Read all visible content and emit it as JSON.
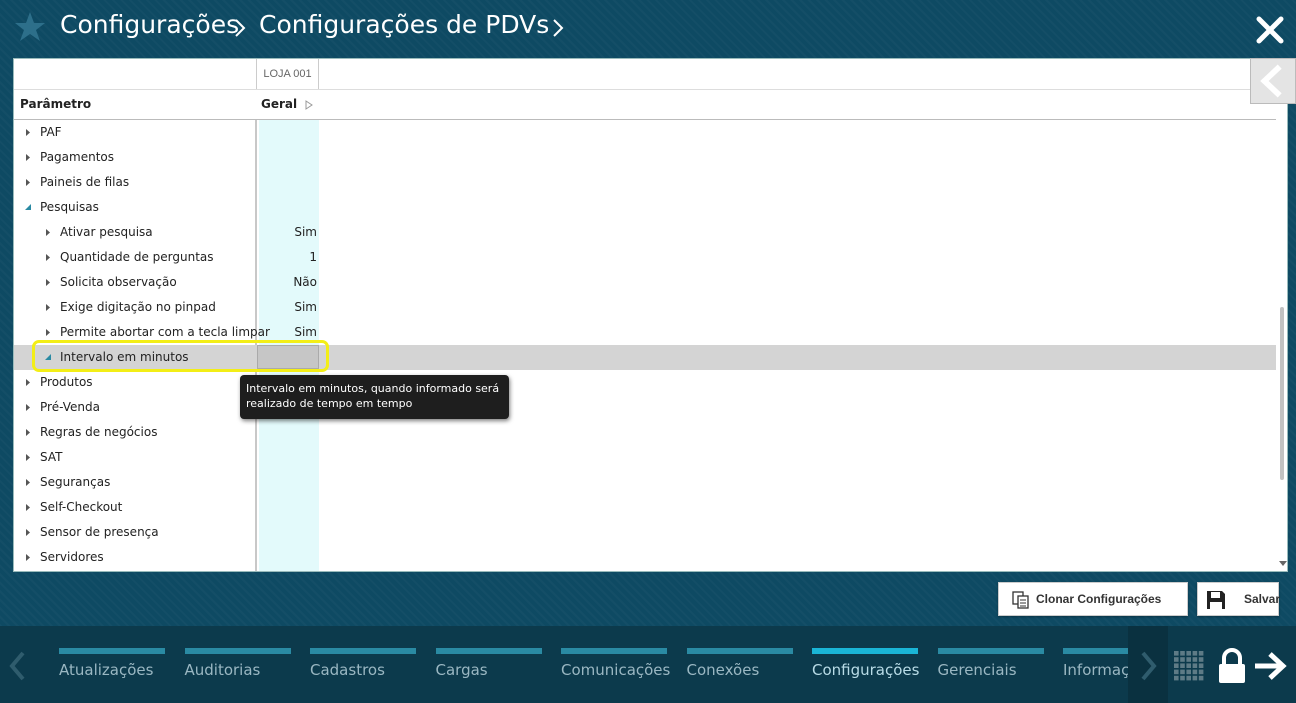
{
  "header": {
    "breadcrumb_1": "Configurações",
    "breadcrumb_2": "Configurações de PDVs",
    "icons": [
      "star-icon",
      "chevron-right-icon",
      "close-icon"
    ]
  },
  "grid": {
    "store_column": "LOJA 001",
    "parameter_header": "Parâmetro",
    "value_header": "Geral",
    "rows": [
      {
        "label": "PAF",
        "value": "",
        "level": 0,
        "expanded": false
      },
      {
        "label": "Pagamentos",
        "value": "",
        "level": 0,
        "expanded": false
      },
      {
        "label": "Paineis de filas",
        "value": "",
        "level": 0,
        "expanded": false
      },
      {
        "label": "Pesquisas",
        "value": "",
        "level": 0,
        "expanded": true
      },
      {
        "label": "Ativar pesquisa",
        "value": "Sim",
        "level": 1,
        "expanded": false
      },
      {
        "label": "Quantidade de perguntas",
        "value": "1",
        "level": 1,
        "expanded": false
      },
      {
        "label": "Solicita observação",
        "value": "Não",
        "level": 1,
        "expanded": false
      },
      {
        "label": "Exige digitação no pinpad",
        "value": "Sim",
        "level": 1,
        "expanded": false
      },
      {
        "label": "Permite abortar com a tecla limpar",
        "value": "Sim",
        "level": 1,
        "expanded": false
      },
      {
        "label": "Intervalo em minutos",
        "value": "",
        "level": 1,
        "expanded": true,
        "selected": true
      },
      {
        "label": "Produtos",
        "value": "",
        "level": 0,
        "expanded": false
      },
      {
        "label": "Pré-Venda",
        "value": "",
        "level": 0,
        "expanded": false
      },
      {
        "label": "Regras de negócios",
        "value": "",
        "level": 0,
        "expanded": false
      },
      {
        "label": "SAT",
        "value": "",
        "level": 0,
        "expanded": false
      },
      {
        "label": "Seguranças",
        "value": "",
        "level": 0,
        "expanded": false
      },
      {
        "label": "Self-Checkout",
        "value": "",
        "level": 0,
        "expanded": false
      },
      {
        "label": "Sensor de presença",
        "value": "",
        "level": 0,
        "expanded": false
      },
      {
        "label": "Servidores",
        "value": "",
        "level": 0,
        "expanded": false
      }
    ],
    "tooltip": "Intervalo em minutos, quando informado será realizado de tempo em tempo"
  },
  "actions": {
    "clone_label": "Clonar Configurações",
    "save_label": "Salvar"
  },
  "nav": {
    "items": [
      "Atualizações",
      "Auditorias",
      "Cadastros",
      "Cargas",
      "Comunicações",
      "Conexões",
      "Configurações",
      "Gerenciais",
      "Informações"
    ],
    "active": "Configurações"
  },
  "colors": {
    "background": "#0e4a63",
    "nav_bar": "#2a8aa3",
    "nav_bar_active": "#1ab5d6",
    "highlight": "#f3ee17",
    "value_column": "#e3fafb"
  }
}
